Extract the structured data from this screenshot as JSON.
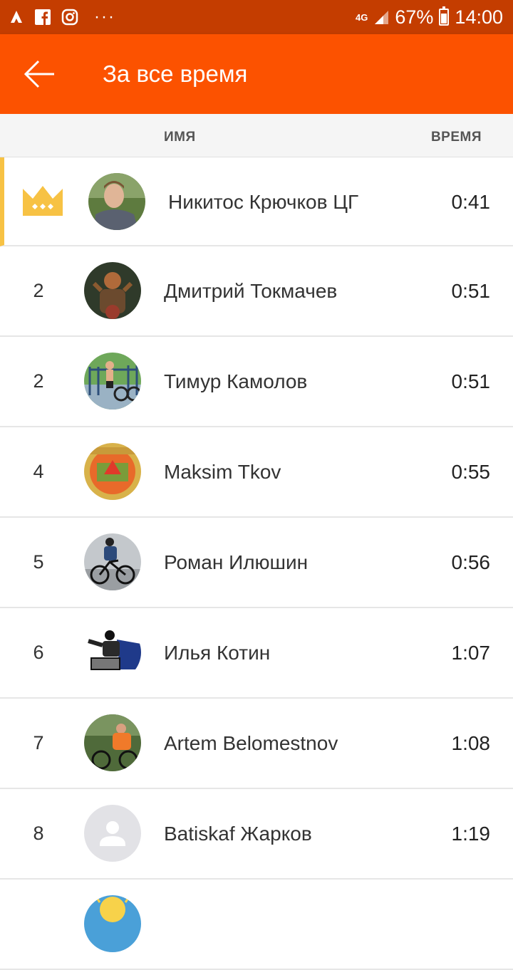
{
  "status_bar": {
    "network": "4G",
    "battery": "67%",
    "time": "14:00",
    "icons": [
      "strava-icon",
      "facebook-icon",
      "instagram-icon",
      "more-dots-icon",
      "signal-icon",
      "battery-icon"
    ]
  },
  "header": {
    "title": "За все время",
    "back_icon": "arrow-left-icon"
  },
  "columns": {
    "name": "ИМЯ",
    "time": "ВРЕМЯ"
  },
  "colors": {
    "accent": "#fc5200",
    "status_bar": "#c43d00",
    "crown": "#f7c244"
  },
  "leaderboard": [
    {
      "rank": "",
      "name": "Никитос Крючков ЦГ",
      "time": "0:41",
      "leader": true
    },
    {
      "rank": "2",
      "name": "Дмитрий Токмачев",
      "time": "0:51"
    },
    {
      "rank": "2",
      "name": "Тимур Камолов",
      "time": "0:51"
    },
    {
      "rank": "4",
      "name": "Maksim Tkov",
      "time": "0:55"
    },
    {
      "rank": "5",
      "name": "Роман Илюшин",
      "time": "0:56"
    },
    {
      "rank": "6",
      "name": "Илья Котин",
      "time": "1:07"
    },
    {
      "rank": "7",
      "name": "Artem Belomestnov",
      "time": "1:08"
    },
    {
      "rank": "8",
      "name": "Batiskaf  Жарков",
      "time": "1:19"
    }
  ]
}
